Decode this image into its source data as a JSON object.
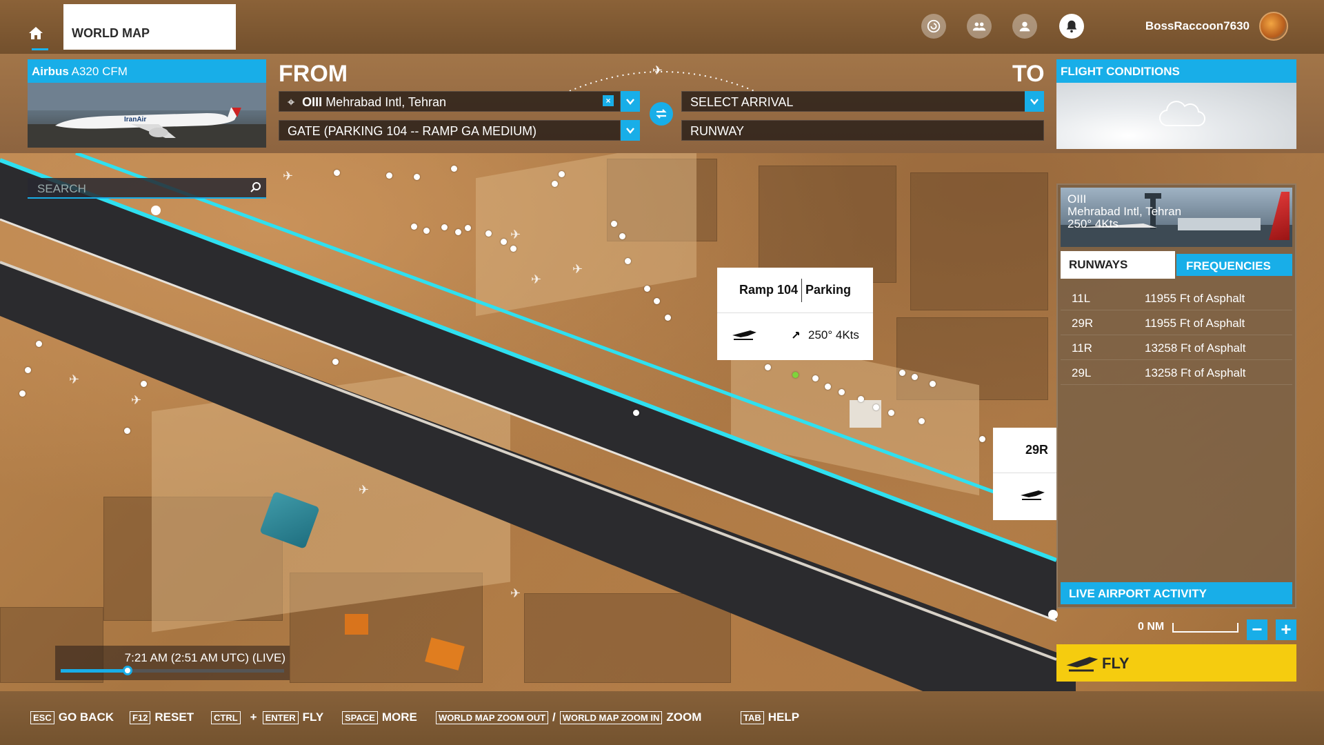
{
  "topbar": {
    "tab_label": "WORLD MAP",
    "username": "BossRaccoon7630",
    "icons": [
      "home-icon",
      "marketplace-icon",
      "friends-icon",
      "profile-icon",
      "notifications-icon"
    ]
  },
  "aircraft": {
    "title_prefix": "Airbus",
    "title_model": "A320 CFM"
  },
  "route": {
    "from_label": "FROM",
    "to_label": "TO",
    "departure": "OIII Mehrabad Intl, Tehran",
    "departure_icao": "OIII",
    "departure_name": "Mehrabad Intl, Tehran",
    "clear_label": "×",
    "departure_spot": "GATE (PARKING 104 -- RAMP GA MEDIUM)",
    "arrival": "SELECT ARRIVAL",
    "arrival_spot": "RUNWAY"
  },
  "flight_conditions": {
    "title": "FLIGHT CONDITIONS"
  },
  "search": {
    "placeholder": "SEARCH"
  },
  "ramp_popup": {
    "name": "Ramp 104",
    "type": "Parking",
    "wind": "250° 4Kts"
  },
  "runway_popup": {
    "name": "29R"
  },
  "airport_panel": {
    "icao": "OIII",
    "name": "Mehrabad Intl, Tehran",
    "wind": "250° 4Kts",
    "tab_runways": "RUNWAYS",
    "tab_frequencies": "FREQUENCIES",
    "runways": [
      {
        "id": "11L",
        "length": "11955 Ft of Asphalt"
      },
      {
        "id": "29R",
        "length": "11955 Ft of Asphalt"
      },
      {
        "id": "11R",
        "length": "13258 Ft of Asphalt"
      },
      {
        "id": "29L",
        "length": "13258 Ft of Asphalt"
      }
    ],
    "live_activity": "LIVE AIRPORT ACTIVITY"
  },
  "map_controls": {
    "scale_label": "0 NM",
    "zoom_out": "−",
    "zoom_in": "+"
  },
  "fly_button": {
    "label": "FLY"
  },
  "time": {
    "label": "7:21 AM (2:51 AM UTC) (LIVE)",
    "progress": 0.3
  },
  "hints": [
    {
      "keys": [
        "ESC"
      ],
      "action": "GO BACK"
    },
    {
      "keys": [
        "F12"
      ],
      "action": "RESET"
    },
    {
      "keys": [
        "CTRL",
        "ENTER"
      ],
      "action": "FLY",
      "joiner": "+"
    },
    {
      "keys": [
        "SPACE"
      ],
      "action": "MORE"
    },
    {
      "keys": [
        "WORLD MAP ZOOM OUT",
        "WORLD MAP ZOOM IN"
      ],
      "action": "ZOOM",
      "joiner": "/"
    },
    {
      "keys": [
        "TAB"
      ],
      "action": "HELP"
    }
  ],
  "colors": {
    "accent": "#18aee8",
    "fly": "#f5cc0f",
    "runway": "#2b2b2e",
    "runway_edge": "#2fe0f0"
  }
}
